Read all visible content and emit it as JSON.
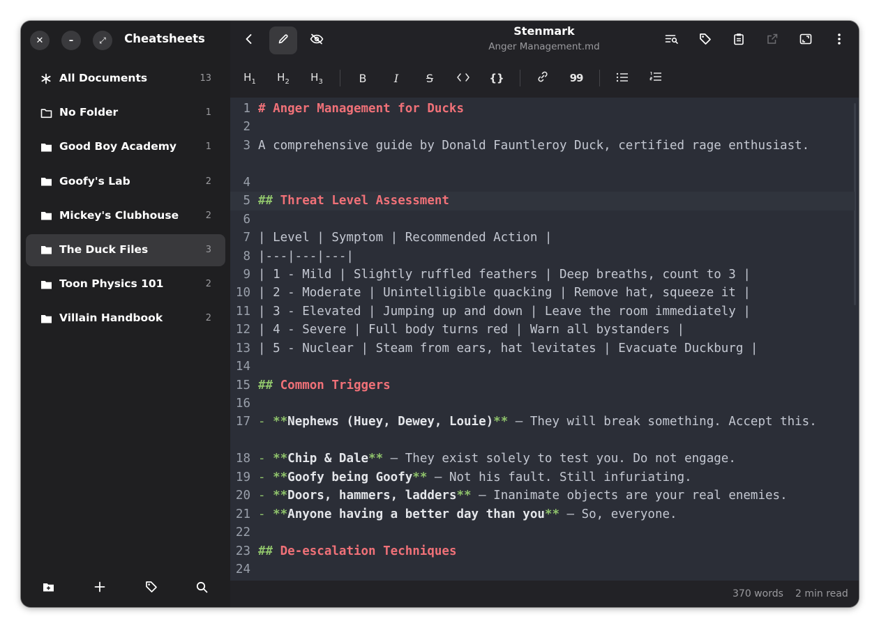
{
  "sidebar": {
    "title": "Cheatsheets",
    "window_buttons": {
      "close": "✕",
      "minimize": "–",
      "maximize": "⤢"
    },
    "items": [
      {
        "label": "All Documents",
        "count": "13",
        "icon": "asterisk-icon"
      },
      {
        "label": "No Folder",
        "count": "1",
        "icon": "folder-outline-icon"
      },
      {
        "label": "Good Boy Academy",
        "count": "1",
        "icon": "folder-icon"
      },
      {
        "label": "Goofy's Lab",
        "count": "2",
        "icon": "folder-icon"
      },
      {
        "label": "Mickey's Clubhouse",
        "count": "2",
        "icon": "folder-icon"
      },
      {
        "label": "The Duck Files",
        "count": "3",
        "icon": "folder-icon",
        "active": true
      },
      {
        "label": "Toon Physics 101",
        "count": "2",
        "icon": "folder-icon"
      },
      {
        "label": "Villain Handbook",
        "count": "2",
        "icon": "folder-icon"
      }
    ],
    "footer_icons": [
      "new-folder-icon",
      "plus-icon",
      "tag-icon",
      "search-icon"
    ]
  },
  "header": {
    "title": "Stenmark",
    "subtitle": "Anger Management.md",
    "left_icons": [
      "back-icon",
      "pencil-icon",
      "eye-slash-icon"
    ],
    "right_icons": [
      "find-replace-icon",
      "tag-icon",
      "clipboard-icon",
      "export-icon",
      "fullscreen-icon",
      "menu-icon"
    ]
  },
  "format_bar": {
    "h1": "H",
    "h2": "H",
    "h3": "H",
    "h1_sub": "1",
    "h2_sub": "2",
    "h3_sub": "3",
    "bold": "B",
    "italic": "I",
    "strike": "S",
    "code": "‹›",
    "code_block": "{}",
    "quote": "99"
  },
  "editor": {
    "current_line": 5,
    "lines": [
      {
        "n": "1",
        "kind": "h1",
        "text": "# Anger Management for Ducks"
      },
      {
        "n": "2",
        "kind": "blank"
      },
      {
        "n": "3",
        "kind": "wrap",
        "text": "A comprehensive guide by Donald Fauntleroy Duck, certified rage enthusiast."
      },
      {
        "n": "4",
        "kind": "blank"
      },
      {
        "n": "5",
        "kind": "h2",
        "mark": "##",
        "text": "Threat Level Assessment"
      },
      {
        "n": "6",
        "kind": "blank"
      },
      {
        "n": "7",
        "kind": "plain",
        "text": "| Level | Symptom | Recommended Action |"
      },
      {
        "n": "8",
        "kind": "plain",
        "text": "|---|---|---|"
      },
      {
        "n": "9",
        "kind": "plain",
        "text": "| 1 - Mild | Slightly ruffled feathers | Deep breaths, count to 3 |"
      },
      {
        "n": "10",
        "kind": "plain",
        "text": "| 2 - Moderate | Unintelligible quacking | Remove hat, squeeze it |"
      },
      {
        "n": "11",
        "kind": "plain",
        "text": "| 3 - Elevated | Jumping up and down | Leave the room immediately |"
      },
      {
        "n": "12",
        "kind": "plain",
        "text": "| 4 - Severe | Full body turns red | Warn all bystanders |"
      },
      {
        "n": "13",
        "kind": "plain",
        "text": "| 5 - Nuclear | Steam from ears, hat levitates | Evacuate Duckburg |"
      },
      {
        "n": "14",
        "kind": "blank"
      },
      {
        "n": "15",
        "kind": "h2",
        "mark": "##",
        "text": "Common Triggers"
      },
      {
        "n": "16",
        "kind": "blank"
      },
      {
        "n": "17",
        "kind": "bulletwrap",
        "bold": "Nephews (Huey, Dewey, Louie)",
        "rest": " — They will break something. Accept this."
      },
      {
        "n": "18",
        "kind": "bullet",
        "bold": "Chip & Dale",
        "rest": " — They exist solely to test you. Do not engage."
      },
      {
        "n": "19",
        "kind": "bullet",
        "bold": "Goofy being Goofy",
        "rest": " — Not his fault. Still infuriating."
      },
      {
        "n": "20",
        "kind": "bullet",
        "bold": "Doors, hammers, ladders",
        "rest": " — Inanimate objects are your real enemies."
      },
      {
        "n": "21",
        "kind": "bullet",
        "bold": "Anyone having a better day than you",
        "rest": " — So, everyone."
      },
      {
        "n": "22",
        "kind": "blank"
      },
      {
        "n": "23",
        "kind": "h2",
        "mark": "##",
        "text": "De-escalation Techniques"
      },
      {
        "n": "24",
        "kind": "blank"
      }
    ]
  },
  "status": {
    "words": "370 words",
    "read_time": "2 min read"
  },
  "colors": {
    "heading": "#f07178",
    "markup": "#8fc36b",
    "editor_bg": "#2b2e37",
    "sidebar_bg": "#1f1f21"
  }
}
